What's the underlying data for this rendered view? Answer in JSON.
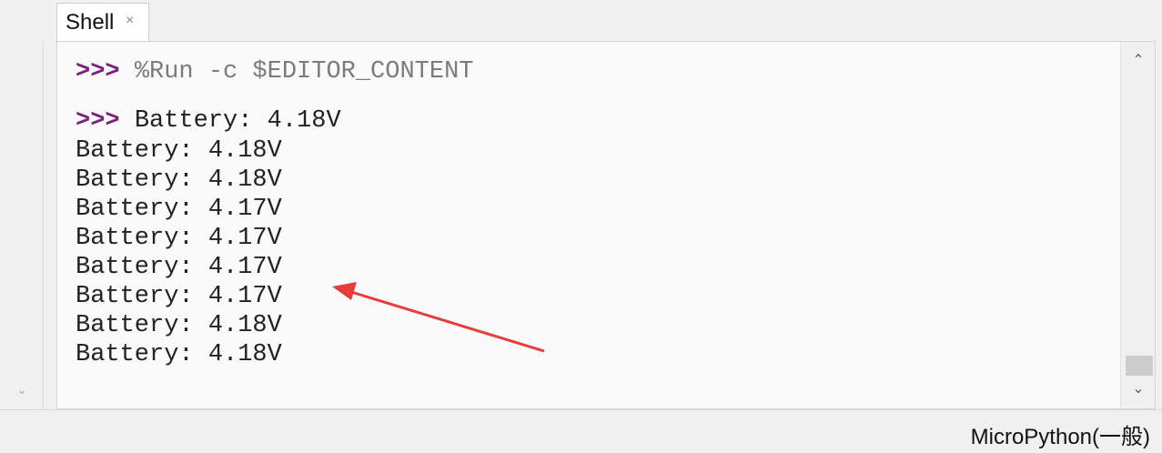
{
  "tabs": [
    {
      "label": "Shell",
      "close_icon": "×"
    }
  ],
  "shell": {
    "prompt": ">>>",
    "command": "%Run -c $EDITOR_CONTENT",
    "first_output": "Battery: 4.18V",
    "output_lines": [
      "Battery: 4.18V",
      "Battery: 4.18V",
      "Battery: 4.17V",
      "Battery: 4.17V",
      "Battery: 4.17V",
      "Battery: 4.17V",
      "Battery: 4.18V",
      "Battery: 4.18V"
    ]
  },
  "status_bar": {
    "interpreter": "MicroPython(一般)"
  },
  "colors": {
    "prompt": "#7a1f7a",
    "command": "#7b7b7b",
    "annotation_arrow": "#e83b3b"
  },
  "icons": {
    "tab_close": "close-icon",
    "scroll_up": "chevron-up-icon",
    "scroll_down": "chevron-down-icon",
    "left_down": "chevron-down-icon",
    "annotation": "red-arrow-icon"
  }
}
